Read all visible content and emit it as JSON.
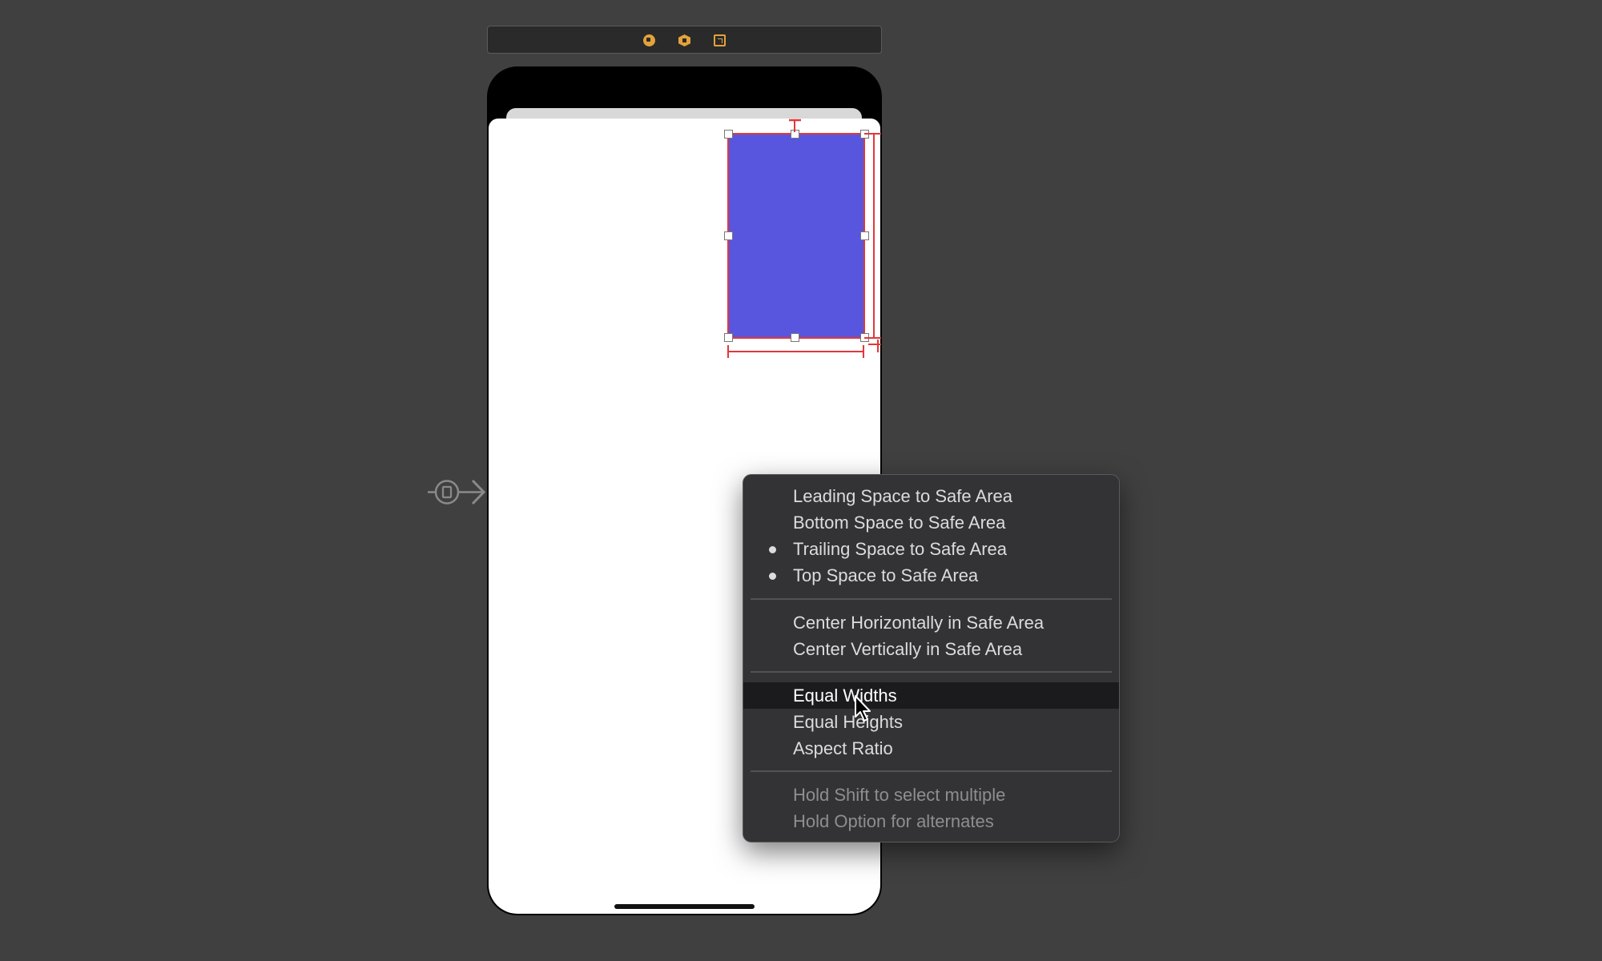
{
  "canvas": {
    "background": "#404040"
  },
  "scene_bar": {
    "icons": [
      "view-controller-icon",
      "first-responder-icon",
      "exit-icon"
    ],
    "accent": "#e3a33a"
  },
  "view": {
    "fill": "#5856df",
    "constraint_color": "#e1383a"
  },
  "menu": {
    "items": [
      {
        "label": "Leading Space to Safe Area",
        "checked": false
      },
      {
        "label": "Bottom Space to Safe Area",
        "checked": false
      },
      {
        "label": "Trailing Space to Safe Area",
        "checked": true
      },
      {
        "label": "Top Space to Safe Area",
        "checked": true
      },
      {
        "label": "Center Horizontally in Safe Area",
        "checked": false
      },
      {
        "label": "Center Vertically in Safe Area",
        "checked": false
      },
      {
        "label": "Equal Widths",
        "checked": false,
        "highlighted": true
      },
      {
        "label": "Equal Heights",
        "checked": false
      },
      {
        "label": "Aspect Ratio",
        "checked": false
      }
    ],
    "hints": [
      "Hold Shift to select multiple",
      "Hold Option for alternates"
    ]
  }
}
